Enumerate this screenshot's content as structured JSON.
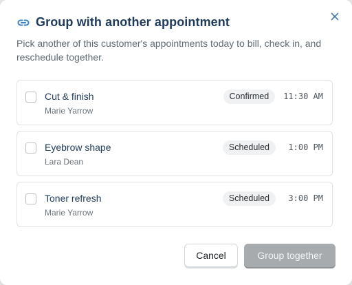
{
  "dialog": {
    "title": "Group with another appointment",
    "description": "Pick another of this customer's appointments today to bill, check in, and reschedule together.",
    "close_icon": "close-icon",
    "title_icon": "link-icon"
  },
  "appointments": [
    {
      "service": "Cut & finish",
      "client": "Marie Yarrow",
      "status": "Confirmed",
      "time": "11:30 AM",
      "checked": false
    },
    {
      "service": "Eyebrow shape",
      "client": "Lara Dean",
      "status": "Scheduled",
      "time": "1:00 PM",
      "checked": false
    },
    {
      "service": "Toner refresh",
      "client": "Marie Yarrow",
      "status": "Scheduled",
      "time": "3:00 PM",
      "checked": false
    }
  ],
  "actions": {
    "cancel_label": "Cancel",
    "group_label": "Group together",
    "group_disabled": true
  },
  "colors": {
    "title": "#1f3a5a",
    "accent_icon": "#3b82c4",
    "disabled_button": "#a7abae"
  }
}
